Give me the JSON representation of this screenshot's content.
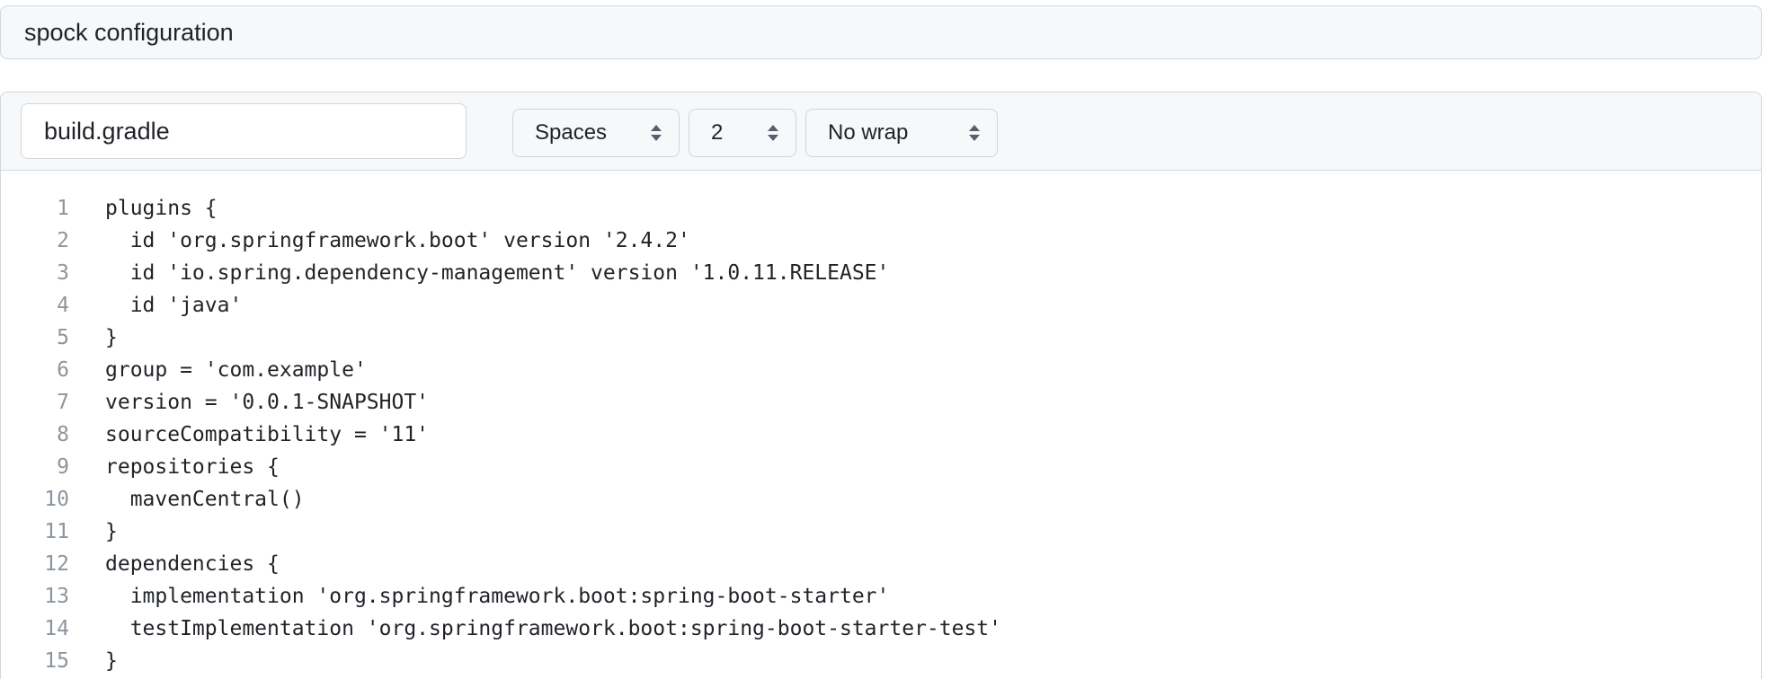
{
  "description": {
    "value": "spock configuration"
  },
  "editor": {
    "filename": "build.gradle",
    "indent_mode": {
      "selected": "Spaces"
    },
    "indent_size": {
      "selected": "2"
    },
    "wrap_mode": {
      "selected": "No wrap"
    },
    "lines": [
      {
        "n": "1",
        "text": "plugins {"
      },
      {
        "n": "2",
        "text": "  id 'org.springframework.boot' version '2.4.2'"
      },
      {
        "n": "3",
        "text": "  id 'io.spring.dependency-management' version '1.0.11.RELEASE'"
      },
      {
        "n": "4",
        "text": "  id 'java'"
      },
      {
        "n": "5",
        "text": "}"
      },
      {
        "n": "6",
        "text": "group = 'com.example'"
      },
      {
        "n": "7",
        "text": "version = '0.0.1-SNAPSHOT'"
      },
      {
        "n": "8",
        "text": "sourceCompatibility = '11'"
      },
      {
        "n": "9",
        "text": "repositories {"
      },
      {
        "n": "10",
        "text": "  mavenCentral()"
      },
      {
        "n": "11",
        "text": "}"
      },
      {
        "n": "12",
        "text": "dependencies {"
      },
      {
        "n": "13",
        "text": "  implementation 'org.springframework.boot:spring-boot-starter'"
      },
      {
        "n": "14",
        "text": "  testImplementation 'org.springframework.boot:spring-boot-starter-test'"
      },
      {
        "n": "15",
        "text": "}"
      }
    ]
  },
  "icons": {
    "select_caret": "up-down-caret-icon"
  },
  "colors": {
    "border": "#d0d7de",
    "header_bg": "#f6f8fa",
    "text": "#1f2328",
    "line_number": "#8c959f"
  }
}
